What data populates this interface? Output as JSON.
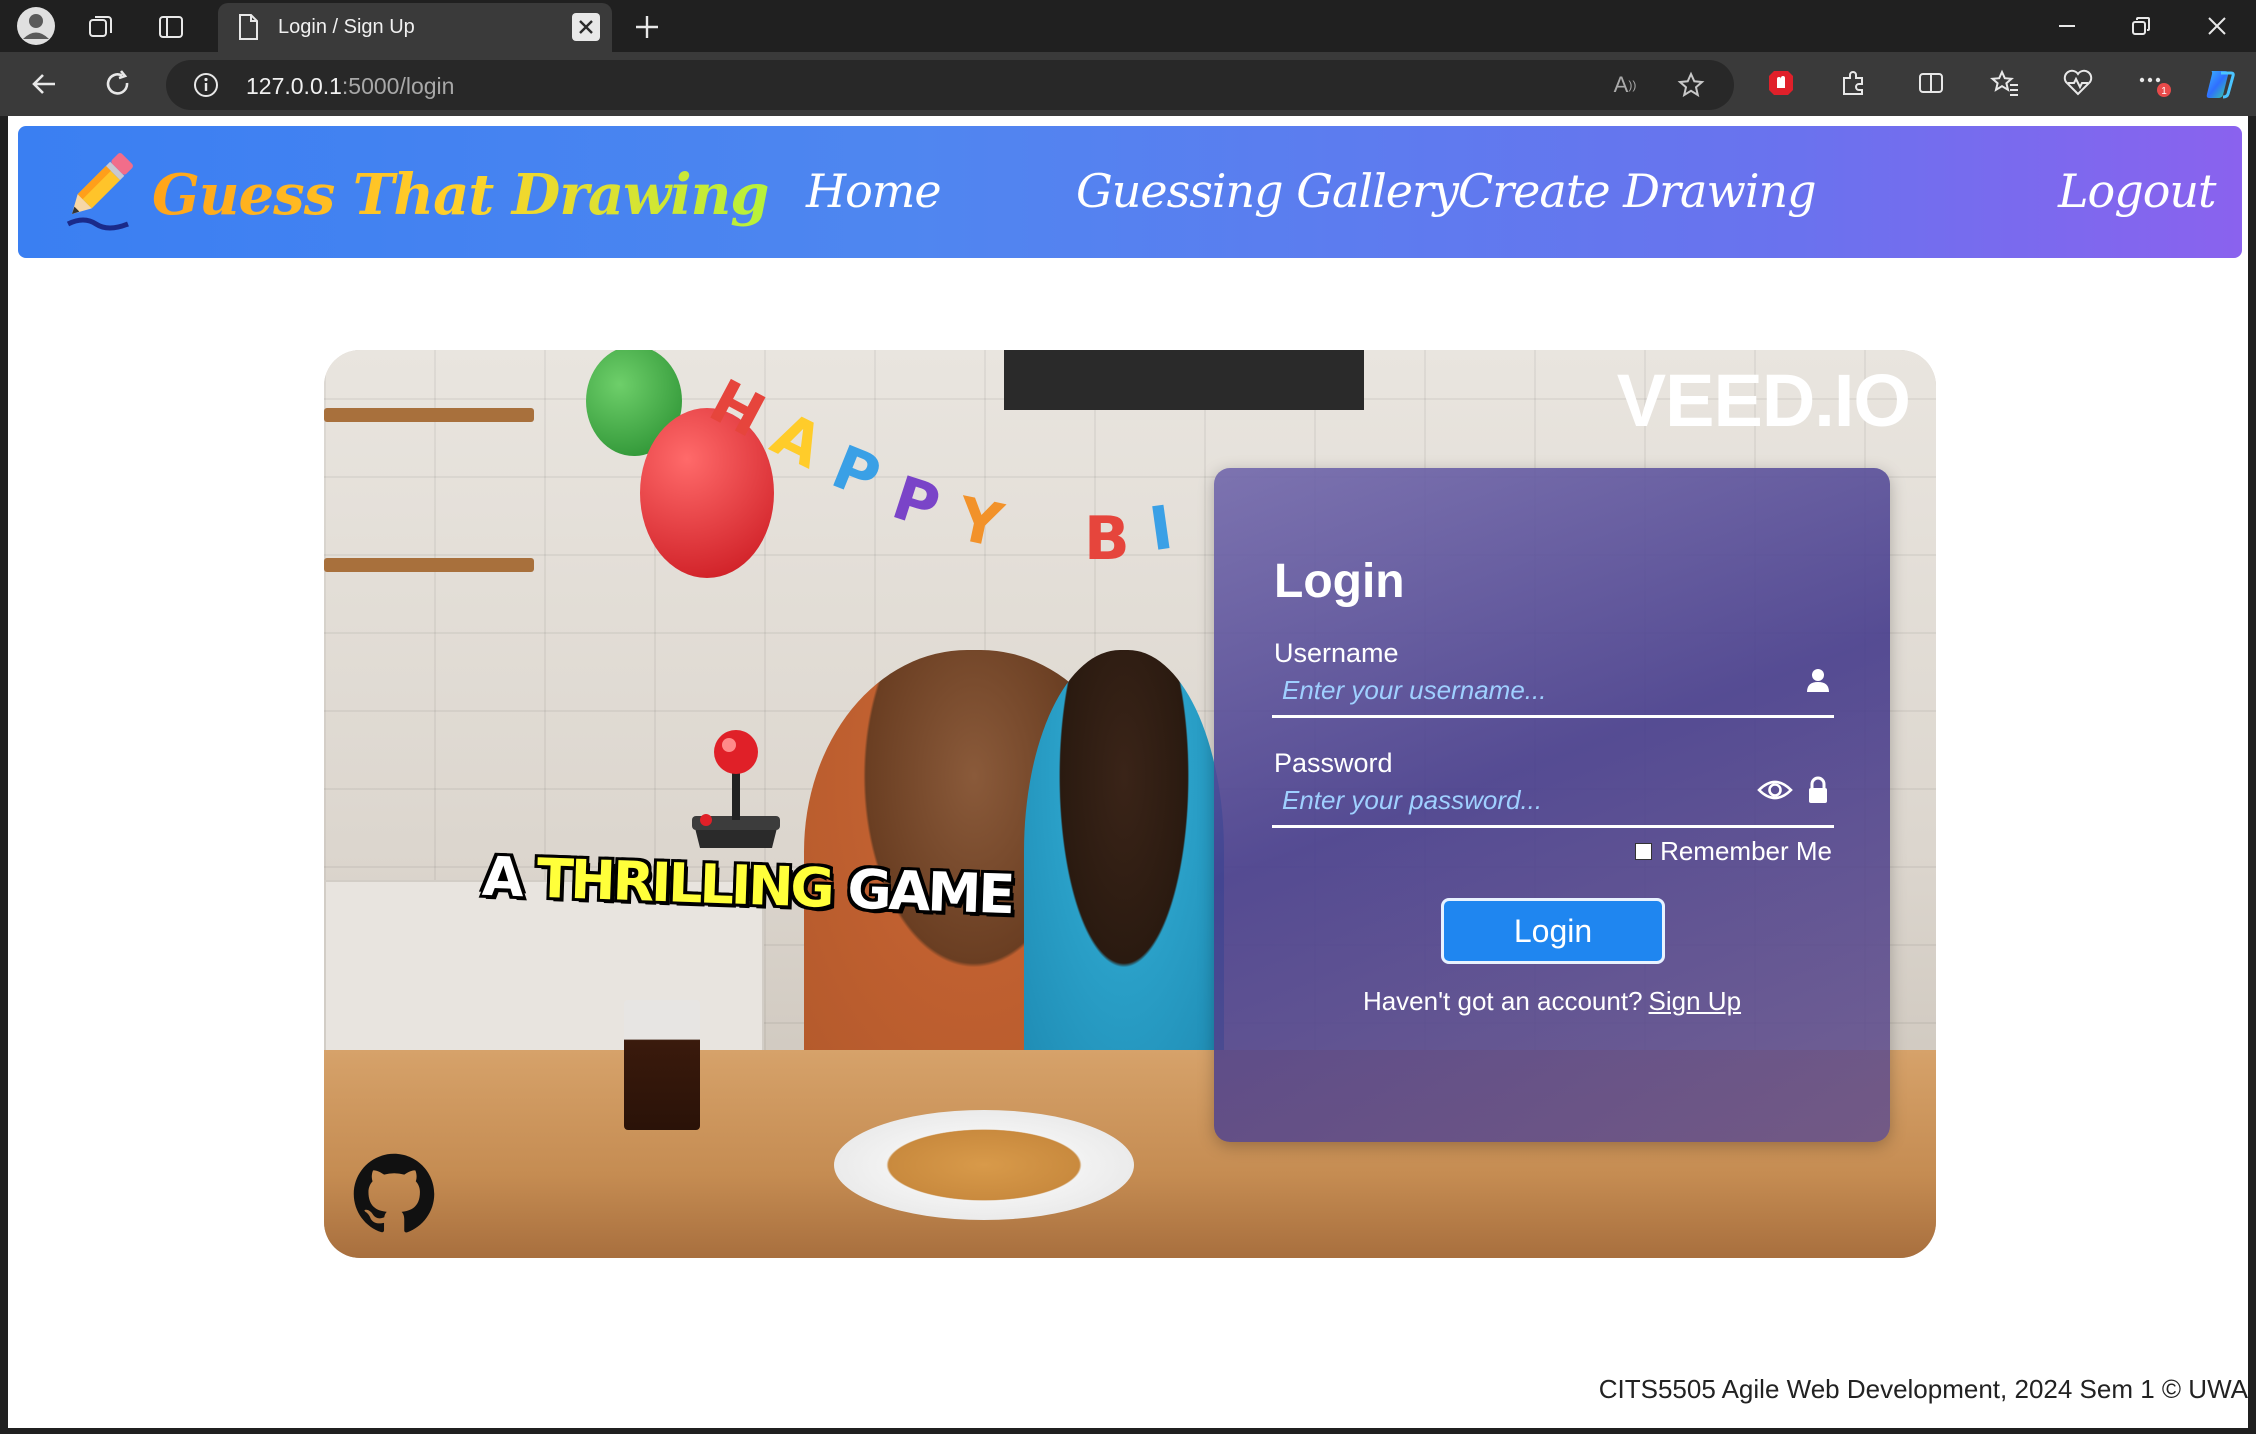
{
  "browser": {
    "tab_title": "Login / Sign Up",
    "url_host": "127.0.0.1",
    "url_path": ":5000/login"
  },
  "nav": {
    "brand": "Guess That Drawing",
    "links": [
      "Home",
      "Guessing Gallery",
      "Create Drawing",
      "Logout"
    ]
  },
  "hero": {
    "watermark": "VEED.IO",
    "tagline_a": "A",
    "tagline_highlight": "THRILLING",
    "tagline_end": "GAME",
    "banner": "HAPPY BIRTHDAY"
  },
  "login": {
    "title": "Login",
    "username_label": "Username",
    "username_placeholder": "Enter your username...",
    "password_label": "Password",
    "password_placeholder": "Enter your password...",
    "remember_label": "Remember Me",
    "button_label": "Login",
    "signup_prompt": "Haven't got an account?",
    "signup_link": "Sign Up"
  },
  "footer": {
    "text": "CITS5505 Agile Web Development, 2024 Sem 1 © UWA"
  },
  "colors": {
    "nav_gradient_start": "#3a7ff2",
    "nav_gradient_end": "#8a62ee",
    "login_button": "#1f86f0",
    "placeholder": "#9fd0ff"
  },
  "icons": [
    "profile-icon",
    "workspaces-icon",
    "tab-actions-icon",
    "page-icon",
    "close-icon",
    "new-tab-icon",
    "back-icon",
    "refresh-icon",
    "info-icon",
    "read-aloud-icon",
    "star-icon",
    "extension-red-icon",
    "puzzle-icon",
    "split-screen-icon",
    "favorites-icon",
    "health-icon",
    "more-icon",
    "copilot-icon",
    "minimize-icon",
    "restore-icon",
    "window-close-icon",
    "pencil-icon",
    "user-icon",
    "eye-icon",
    "lock-icon",
    "github-icon"
  ]
}
